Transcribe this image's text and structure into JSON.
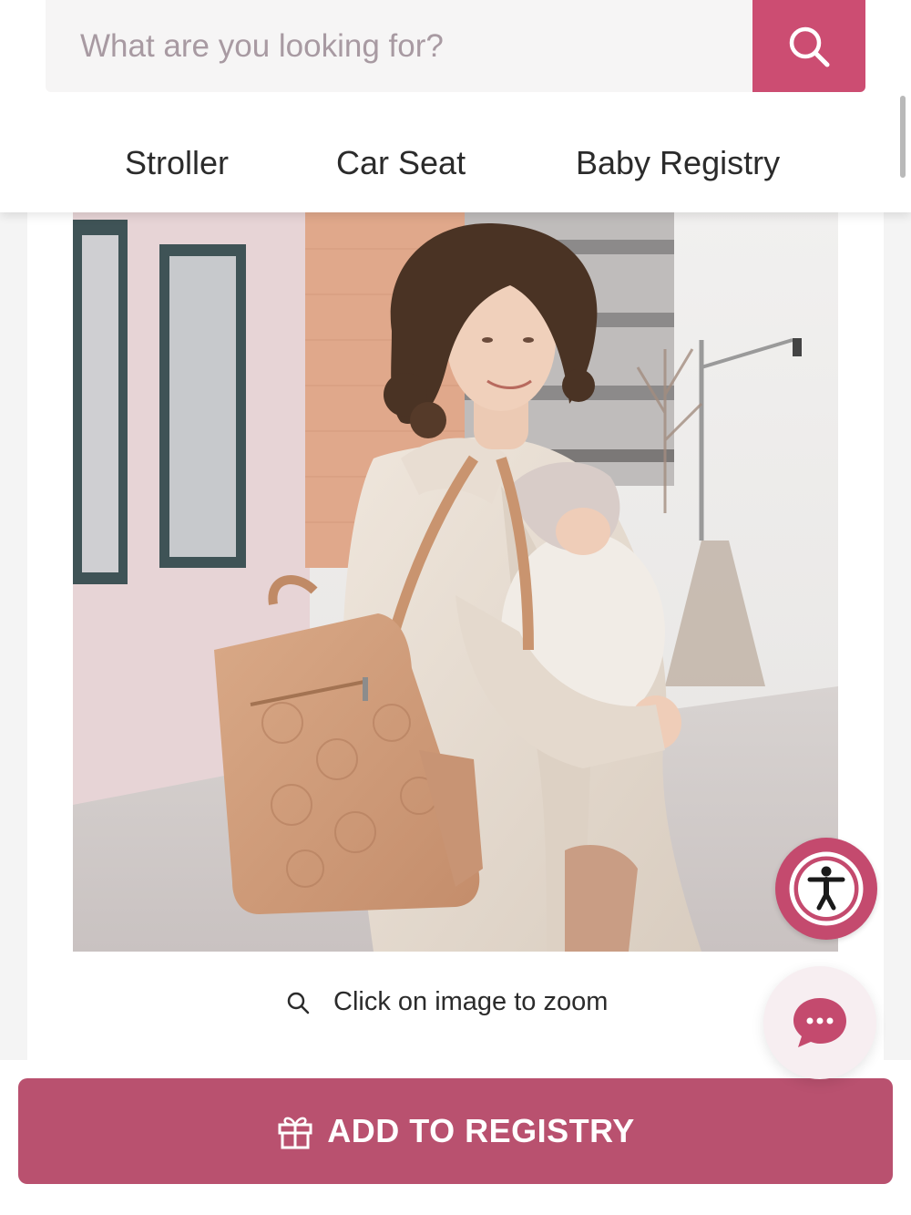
{
  "search": {
    "placeholder": "What are you looking for?",
    "button_icon": "search-icon"
  },
  "nav": {
    "items": [
      {
        "label": "Stroller"
      },
      {
        "label": "Car Seat"
      },
      {
        "label": "Baby Registry"
      }
    ]
  },
  "product": {
    "image_subject": "woman carrying baby in carrier wearing tan quilted backpack diaper bag",
    "zoom_hint": "Click on image to zoom",
    "zoom_icon": "magnifier-icon"
  },
  "floating": {
    "accessibility_icon": "accessibility-icon",
    "chat_icon": "chat-bubble-icon"
  },
  "registry": {
    "label": "ADD TO REGISTRY",
    "icon": "gift-icon"
  },
  "colors": {
    "accent": "#cc4d72",
    "registry_button": "#b9516f",
    "text": "#2b2b2b",
    "placeholder": "#a89aa2"
  }
}
